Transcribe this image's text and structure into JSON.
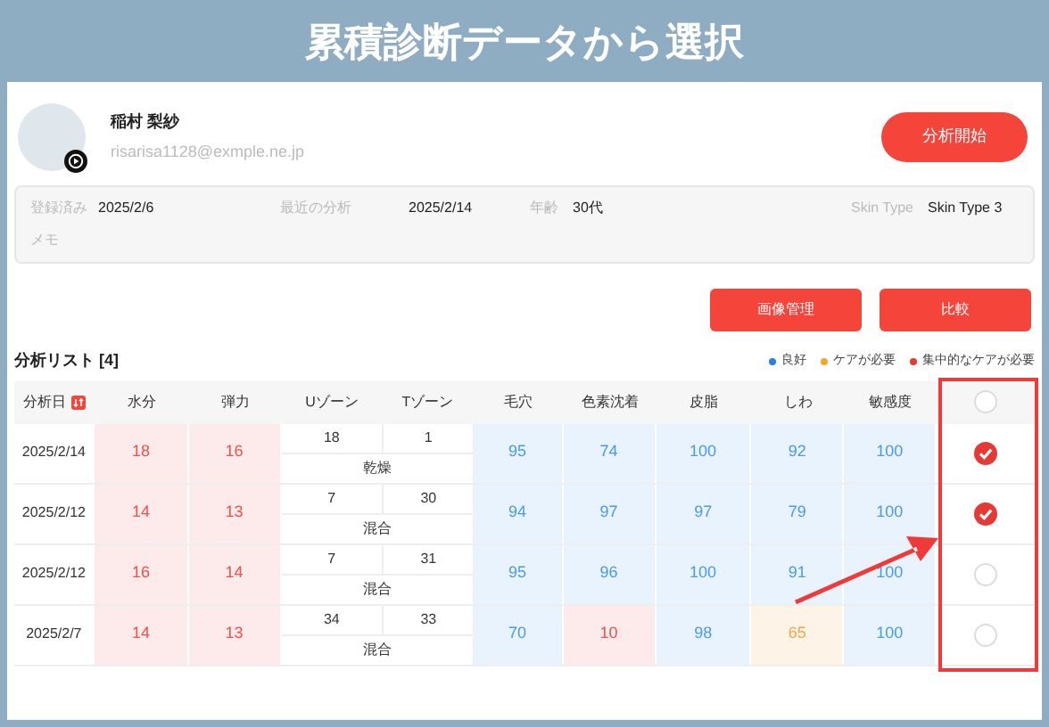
{
  "banner": {
    "title": "累積診断データから選択"
  },
  "profile": {
    "name": "稲村 梨紗",
    "email": "risarisa1128@exmple.ne.jp",
    "start_button": "分析開始"
  },
  "info": {
    "fields": [
      {
        "label": "登録済み",
        "value": "2025/2/6"
      },
      {
        "label": "最近の分析",
        "value": "2025/2/14"
      },
      {
        "label": "年齢",
        "value": "30代"
      },
      {
        "label": "Skin Type",
        "value": "Skin Type 3"
      }
    ],
    "memo_label": "メモ"
  },
  "buttons": [
    "画像管理",
    "比較"
  ],
  "list": {
    "title": "分析リスト [4]",
    "legend": [
      {
        "label": "良好",
        "color": "#2a7de1"
      },
      {
        "label": "ケアが必要",
        "color": "#f5a623"
      },
      {
        "label": "集中的なケアが必要",
        "color": "#e53935"
      }
    ],
    "columns": [
      "分析日",
      "水分",
      "弾力",
      "Uゾーン",
      "Tゾーン",
      "毛穴",
      "色素沈着",
      "皮脂",
      "しわ",
      "敏感度"
    ],
    "header_checkbox": {
      "checked": false
    },
    "rows": [
      {
        "date": "2025/2/14",
        "left_scores": [
          {
            "value": "18",
            "color": "#f0504a"
          },
          {
            "value": "16",
            "color": "#f0504a"
          }
        ],
        "u_zone": "18",
        "t_zone": "1",
        "zone_type": "乾燥",
        "right_scores": [
          {
            "value": "95",
            "color": "#4a9ae8"
          },
          {
            "value": "74",
            "color": "#4a9ae8"
          },
          {
            "value": "100",
            "color": "#4a9ae8"
          },
          {
            "value": "92",
            "color": "#4a9ae8"
          },
          {
            "value": "100",
            "color": "#4a9ae8"
          }
        ],
        "selected": true
      },
      {
        "date": "2025/2/12",
        "left_scores": [
          {
            "value": "14",
            "color": "#f0504a"
          },
          {
            "value": "13",
            "color": "#f0504a"
          }
        ],
        "u_zone": "7",
        "t_zone": "30",
        "zone_type": "混合",
        "right_scores": [
          {
            "value": "94",
            "color": "#4a9ae8"
          },
          {
            "value": "97",
            "color": "#4a9ae8"
          },
          {
            "value": "97",
            "color": "#4a9ae8"
          },
          {
            "value": "79",
            "color": "#4a9ae8"
          },
          {
            "value": "100",
            "color": "#4a9ae8"
          }
        ],
        "selected": true
      },
      {
        "date": "2025/2/12",
        "left_scores": [
          {
            "value": "16",
            "color": "#f0504a"
          },
          {
            "value": "14",
            "color": "#f0504a"
          }
        ],
        "u_zone": "7",
        "t_zone": "31",
        "zone_type": "混合",
        "right_scores": [
          {
            "value": "95",
            "color": "#4a9ae8"
          },
          {
            "value": "96",
            "color": "#4a9ae8"
          },
          {
            "value": "100",
            "color": "#4a9ae8"
          },
          {
            "value": "91",
            "color": "#4a9ae8"
          },
          {
            "value": "100",
            "color": "#4a9ae8"
          }
        ],
        "selected": false
      },
      {
        "date": "2025/2/7",
        "left_scores": [
          {
            "value": "14",
            "color": "#f0504a"
          },
          {
            "value": "13",
            "color": "#f0504a"
          }
        ],
        "u_zone": "34",
        "t_zone": "33",
        "zone_type": "混合",
        "right_scores": [
          {
            "value": "70",
            "color": "#4a9ae8"
          },
          {
            "value": "10",
            "color": "#f0504a"
          },
          {
            "value": "98",
            "color": "#4a9ae8"
          },
          {
            "value": "65",
            "color": "#f5a64a"
          },
          {
            "value": "100",
            "color": "#4a9ae8"
          }
        ],
        "selected": false
      }
    ]
  }
}
